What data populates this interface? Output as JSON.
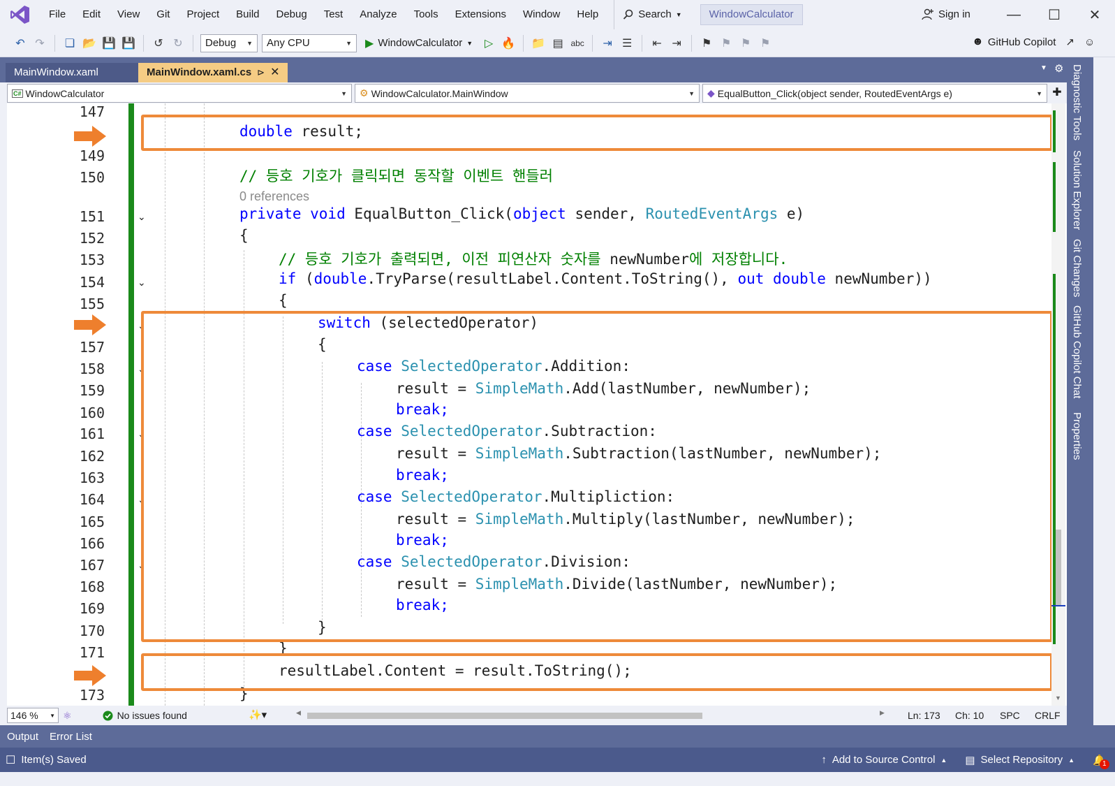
{
  "menu": {
    "items": [
      "File",
      "Edit",
      "View",
      "Git",
      "Project",
      "Build",
      "Debug",
      "Test",
      "Analyze",
      "Tools",
      "Extensions",
      "Window",
      "Help"
    ],
    "search_label": "Search",
    "project_name": "WindowCalculator",
    "sign_in": "Sign in"
  },
  "toolbar": {
    "configuration": "Debug",
    "platform": "Any CPU",
    "run_target": "WindowCalculator",
    "copilot": "GitHub Copilot"
  },
  "tabs": [
    {
      "label": "MainWindow.xaml",
      "active": false
    },
    {
      "label": "MainWindow.xaml.cs",
      "active": true
    }
  ],
  "navbar": {
    "project": "WindowCalculator",
    "type": "WindowCalculator.MainWindow",
    "member": "EqualButton_Click(object sender, RoutedEventArgs e)"
  },
  "side_tabs": [
    "Diagnostic Tools",
    "Solution Explorer",
    "Git Changes",
    "GitHub Copilot Chat",
    "Properties"
  ],
  "code": {
    "line_numbers": [
      "147",
      "149",
      "150",
      "151",
      "152",
      "153",
      "154",
      "155",
      "157",
      "158",
      "159",
      "160",
      "161",
      "162",
      "163",
      "164",
      "165",
      "166",
      "167",
      "168",
      "169",
      "170",
      "171",
      "173"
    ],
    "codelens": "0 references",
    "lines": [
      "double result;",
      "// 등호 기호가 클릭되면 동작할 이벤트 핸들러",
      "private void EqualButton_Click(object sender, RoutedEventArgs e)",
      "{",
      "// 등호 기호가 출력되면, 이전 피연산자 숫자를 newNumber에 저장합니다.",
      "if (double.TryParse(resultLabel.Content.ToString(), out double newNumber))",
      "{",
      "switch (selectedOperator)",
      "{",
      "case SelectedOperator.Addition:",
      "result = SimpleMath.Add(lastNumber, newNumber);",
      "break;",
      "case SelectedOperator.Subtraction:",
      "result = SimpleMath.Subtraction(lastNumber, newNumber);",
      "break;",
      "case SelectedOperator.Multipliction:",
      "result = SimpleMath.Multiply(lastNumber, newNumber);",
      "break;",
      "case SelectedOperator.Division:",
      "result = SimpleMath.Divide(lastNumber, newNumber);",
      "break;",
      "}",
      "}",
      "resultLabel.Content = result.ToString();",
      "}"
    ]
  },
  "editor_status": {
    "zoom": "146 %",
    "issues": "No issues found",
    "line": "Ln: 173",
    "col": "Ch: 10",
    "whitespace": "SPC",
    "line_ending": "CRLF"
  },
  "bottom_tabs": [
    "Output",
    "Error List"
  ],
  "statusbar": {
    "message": "Item(s) Saved",
    "source_control": "Add to Source Control",
    "repository": "Select Repository",
    "notifications": "1"
  },
  "colors": {
    "accent": "#5d6b99",
    "highlight_box": "#ee8a3a",
    "keyword": "#0000ff",
    "type": "#2b91af",
    "comment": "#008000",
    "change_bar": "#1b8a1b"
  }
}
